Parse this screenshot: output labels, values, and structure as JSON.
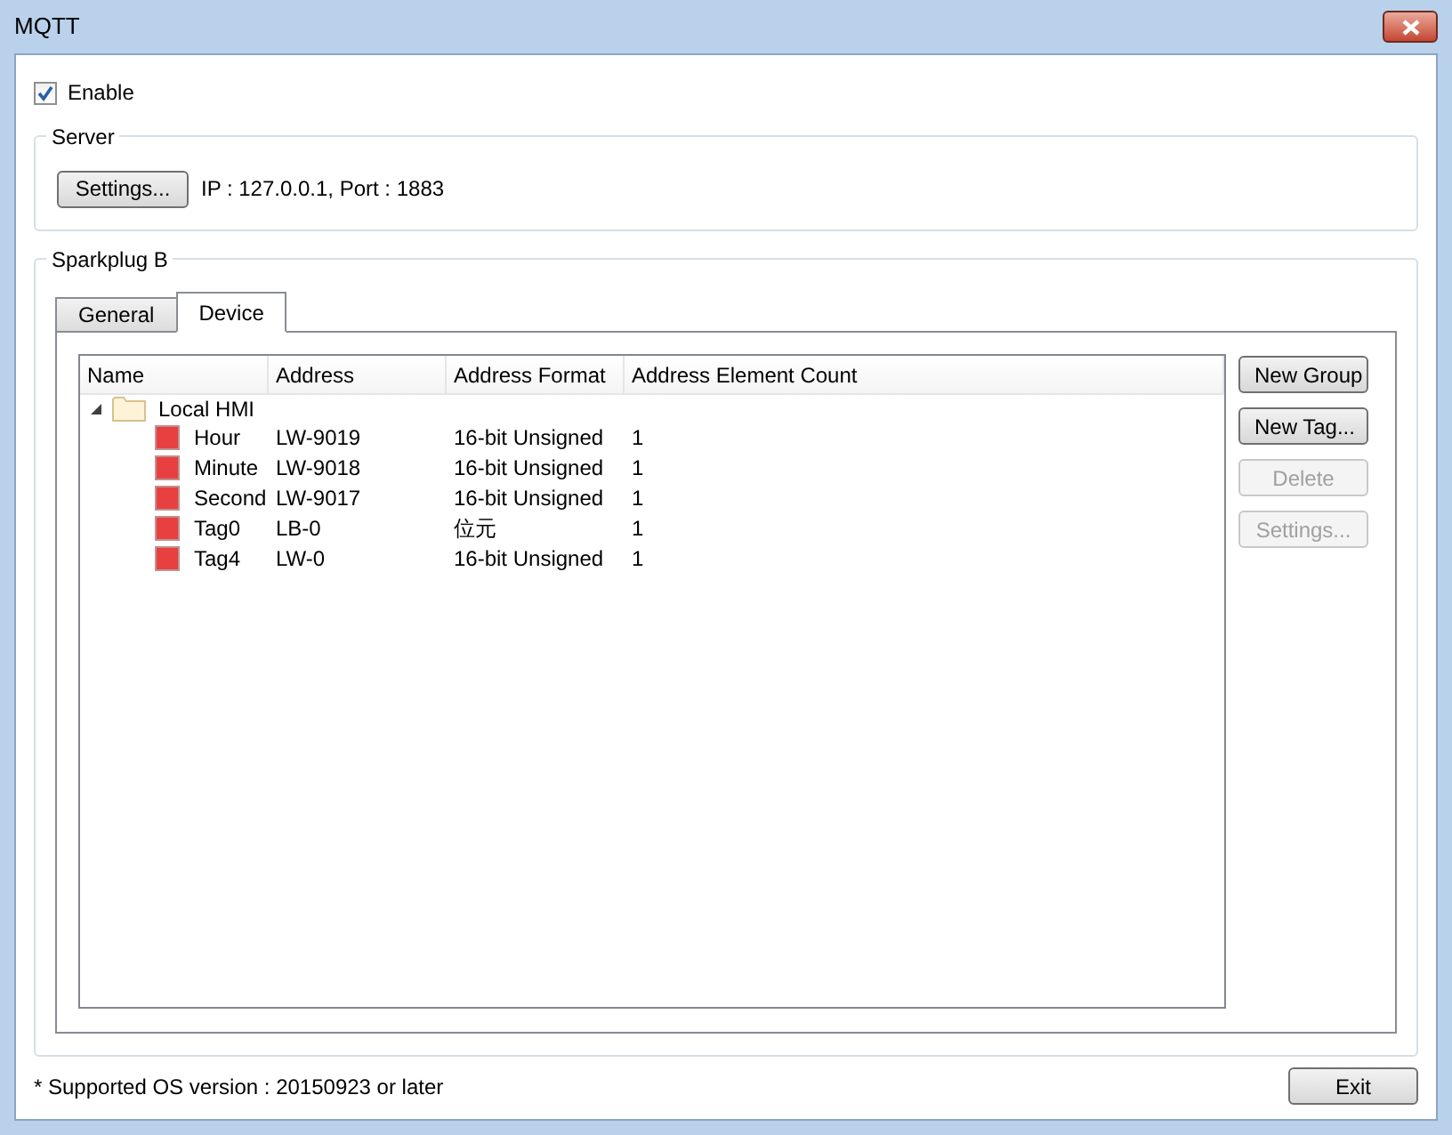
{
  "window": {
    "title": "MQTT"
  },
  "enable": {
    "label": "Enable",
    "checked": true
  },
  "server": {
    "title": "Server",
    "settings_button": "Settings...",
    "info": "IP : 127.0.0.1, Port : 1883"
  },
  "sparkplug": {
    "title": "Sparkplug B",
    "tabs": [
      {
        "label": "General",
        "selected": false
      },
      {
        "label": "Device",
        "selected": true
      }
    ],
    "columns": [
      "Name",
      "Address",
      "Address Format",
      "Address Element Count"
    ],
    "tree": [
      {
        "name": "Local HMI",
        "expanded": true,
        "children": [
          {
            "name": "Hour",
            "address": "LW-9019",
            "format": "16-bit Unsigned",
            "count": "1"
          },
          {
            "name": "Minute",
            "address": "LW-9018",
            "format": "16-bit Unsigned",
            "count": "1"
          },
          {
            "name": "Second",
            "address": "LW-9017",
            "format": "16-bit Unsigned",
            "count": "1"
          },
          {
            "name": "Tag0",
            "address": "LB-0",
            "format": "位元",
            "count": "1"
          },
          {
            "name": "Tag4",
            "address": "LW-0",
            "format": "16-bit Unsigned",
            "count": "1"
          }
        ]
      }
    ],
    "buttons": [
      {
        "label": "New Group",
        "disabled": false
      },
      {
        "label": "New Tag...",
        "disabled": false
      },
      {
        "label": "Delete",
        "disabled": true
      },
      {
        "label": "Settings...",
        "disabled": true
      }
    ]
  },
  "footer": {
    "note": "* Supported OS version : 20150923 or later",
    "exit_button": "Exit"
  }
}
